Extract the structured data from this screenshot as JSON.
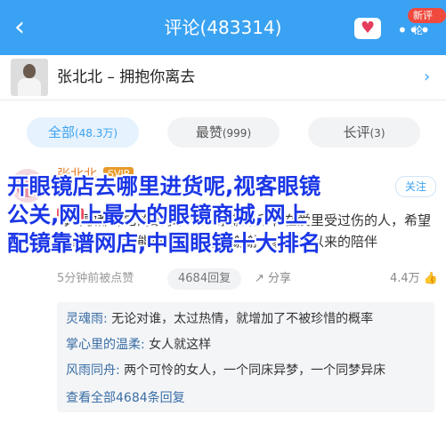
{
  "header": {
    "back_icon": "chevron-left-icon",
    "title": "评论(483314)",
    "heart_icon": "heart-icon",
    "badge": "新评论",
    "more_icon": "more-dots-icon",
    "color": "#3aa2f2"
  },
  "song": {
    "title": "张北北 – 拥抱你离去",
    "chevron_icon": "chevron-right-icon"
  },
  "tabs": [
    {
      "label": "全部",
      "count": "(48.3万)",
      "active": true
    },
    {
      "label": "最赞",
      "count": "(999)",
      "active": false
    },
    {
      "label": "长评",
      "count": "(3)",
      "active": false
    }
  ],
  "comment": {
    "user": "张北北",
    "vip": "SVIP",
    "tag": "歌手",
    "follow_label": "关注",
    "text": "每首歌都有它的故事，这首歌献给所有在爱里受过伤的人，希望大家的生活都能被温柔以待，谢谢大家一直以来的陪伴",
    "time": "5分钟前被点赞",
    "reply_count": "4684回复",
    "share": "分享",
    "likes": "4.4万"
  },
  "replies": [
    {
      "user": "灵魂雨:",
      "text": "无论对谁，太过热情，就增加了不被珍惜的概率"
    },
    {
      "user": "掌心里的温柔:",
      "text": "女人就这样"
    },
    {
      "user": "风雨同舟:",
      "text": "两个可怜的女人，一个同床异梦，一个同梦异床"
    }
  ],
  "view_all": "查看全部4684条回复",
  "overlay": "开眼镜店去哪里进货呢,视客眼镜\n公关,网上最大的眼镜商城,网上\n配镜靠谱网店,中国眼镜十大排名"
}
